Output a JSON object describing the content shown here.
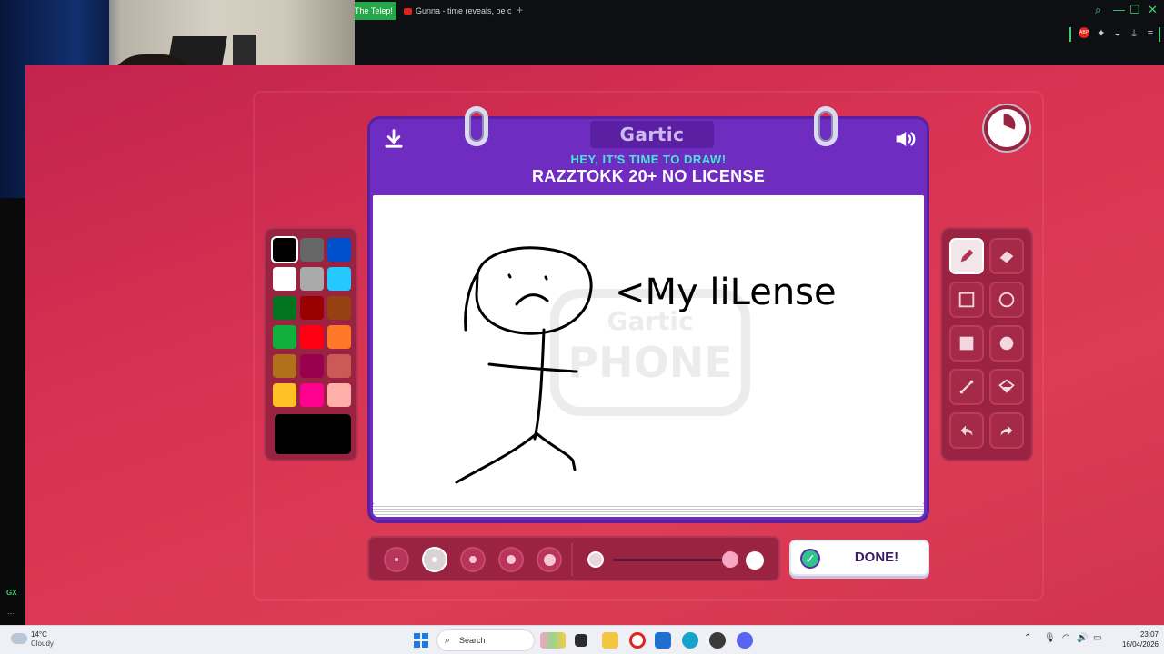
{
  "browser": {
    "tabs": [
      {
        "label": "The Telep!",
        "active": true
      },
      {
        "label": "Gunna - time reveals, be c",
        "active": false
      }
    ],
    "new_tab_symbol": "+",
    "window_controls": [
      "search-icon",
      "minimize-icon",
      "maximize-icon",
      "close-icon"
    ],
    "extension_badge": "ABP"
  },
  "side_panel": {
    "logo": "GX",
    "more": "..."
  },
  "game": {
    "brand": "Gartic",
    "subtitle": "HEY, IT'S TIME TO DRAW!",
    "prompt": "RAZZTOKK 20+ NO LICENSE",
    "watermark_top": "Gartic",
    "watermark_bottom": "PHONE",
    "drawing_text": "<My liLense",
    "done_label": "DONE!",
    "palette": [
      "#000000",
      "#666666",
      "#0050cd",
      "#ffffff",
      "#aaaaaa",
      "#26c9ff",
      "#017420",
      "#990000",
      "#964112",
      "#11b03c",
      "#ff0013",
      "#ff7829",
      "#b0701c",
      "#99004e",
      "#cb5a57",
      "#ffc126",
      "#ff008f",
      "#feafa8"
    ],
    "selected_color": "#000000",
    "tools": [
      {
        "name": "pencil-tool",
        "active": true
      },
      {
        "name": "eraser-tool",
        "active": false
      },
      {
        "name": "rectangle-outline-tool",
        "active": false
      },
      {
        "name": "ellipse-outline-tool",
        "active": false
      },
      {
        "name": "rectangle-fill-tool",
        "active": false
      },
      {
        "name": "ellipse-fill-tool",
        "active": false
      },
      {
        "name": "line-tool",
        "active": false
      },
      {
        "name": "fill-bucket-tool",
        "active": false
      },
      {
        "name": "undo-tool",
        "active": false
      },
      {
        "name": "redo-tool",
        "active": false
      }
    ],
    "brush_sizes": [
      1,
      2,
      3,
      4,
      5
    ],
    "selected_brush_size": 2,
    "opacity_fraction": 0.85
  },
  "taskbar": {
    "weather_temp": "14°C",
    "weather_cond": "Cloudy",
    "search_label": "Search",
    "time": "23:07",
    "date": "16/04/2026"
  }
}
